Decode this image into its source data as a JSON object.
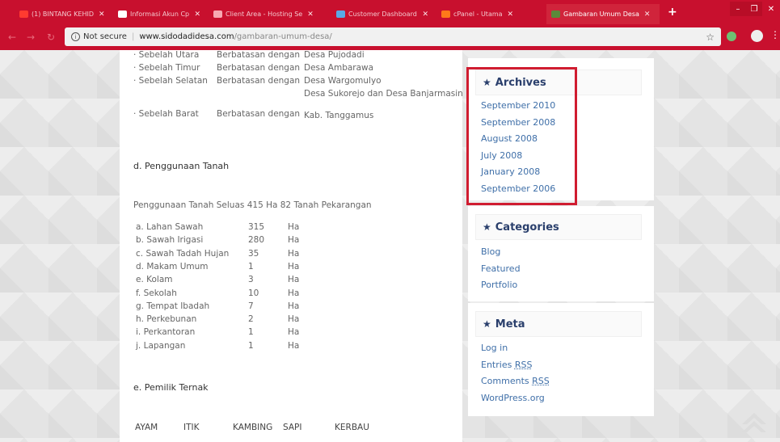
{
  "browser": {
    "tabs": [
      {
        "title": "(1) BINTANG KEHID",
        "favicon_color": "#ff3b30",
        "active": false
      },
      {
        "title": "Informasi Akun Cpanel",
        "favicon_color": "#ffffff",
        "active": false
      },
      {
        "title": "Client Area - Hosting Se",
        "favicon_color": "#f7a8b2",
        "active": false
      },
      {
        "title": "Customer Dashboard - ",
        "favicon_color": "#5aa9e6",
        "active": false
      },
      {
        "title": "cPanel - Utama",
        "favicon_color": "#ff7a1a",
        "active": false
      },
      {
        "title": "Gambaran Umum Desa",
        "favicon_color": "#5b8a3a",
        "active": true
      }
    ],
    "security_label": "Not secure",
    "url_host": "www.sidodadidesa.com",
    "url_path": "/gambaran-umum-desa/"
  },
  "borders": {
    "rows": [
      {
        "side": "· Sebelah Utara",
        "relation": "Berbatasan dengan",
        "neighbor": "Desa Pujodadi"
      },
      {
        "side": "· Sebelah Timur",
        "relation": "Berbatasan dengan",
        "neighbor": "Desa Ambarawa"
      },
      {
        "side": "· Sebelah Selatan",
        "relation": "Berbatasan dengan",
        "neighbor": "Desa Wargomulyo"
      },
      {
        "side": "",
        "relation": "",
        "neighbor": "Desa Sukorejo dan Desa Banjarmasin"
      },
      {
        "side": "· Sebelah Barat",
        "relation": "Berbatasan dengan",
        "neighbor": "Kab. Tanggamus"
      }
    ]
  },
  "land_use": {
    "heading": "d. Penggunaan Tanah",
    "summary": "Penggunaan Tanah Seluas 415 Ha 82 Tanah Pekarangan",
    "rows": [
      {
        "label": "a. Lahan Sawah",
        "value": "315",
        "unit": "Ha"
      },
      {
        "label": "b. Sawah Irigasi",
        "value": "280",
        "unit": "Ha"
      },
      {
        "label": "c. Sawah Tadah Hujan",
        "value": "35",
        "unit": "Ha"
      },
      {
        "label": "d. Makam Umum",
        "value": "1",
        "unit": "Ha"
      },
      {
        "label": "e. Kolam",
        "value": "3",
        "unit": "Ha"
      },
      {
        "label": "f. Sekolah",
        "value": "10",
        "unit": "Ha"
      },
      {
        "label": "g. Tempat Ibadah",
        "value": "7",
        "unit": "Ha"
      },
      {
        "label": "h. Perkebunan",
        "value": "2",
        "unit": "Ha"
      },
      {
        "label": "i. Perkantoran",
        "value": "1",
        "unit": "Ha"
      },
      {
        "label": "j. Lapangan",
        "value": "1",
        "unit": "Ha"
      }
    ]
  },
  "livestock": {
    "heading": "e. Pemilik Ternak",
    "columns": [
      "AYAM",
      "ITIK",
      "KAMBING",
      "SAPI",
      "KERBAU"
    ]
  },
  "sidebar": {
    "archives": {
      "title": "Archives",
      "links": [
        "September 2010",
        "September 2008",
        "August 2008",
        "July 2008",
        "January 2008",
        "September 2006"
      ]
    },
    "categories": {
      "title": "Categories",
      "links": [
        "Blog",
        "Featured",
        "Portfolio"
      ]
    },
    "meta": {
      "title": "Meta",
      "links": [
        {
          "pre": "Log in",
          "abbr": ""
        },
        {
          "pre": "Entries ",
          "abbr": "RSS"
        },
        {
          "pre": "Comments ",
          "abbr": "RSS"
        },
        {
          "pre": "WordPress.org",
          "abbr": ""
        }
      ]
    }
  },
  "colors": {
    "browser_red": "#c8102e",
    "widget_title": "#2a3f6c",
    "link": "#3f6fa8",
    "highlight": "#d01c30"
  }
}
